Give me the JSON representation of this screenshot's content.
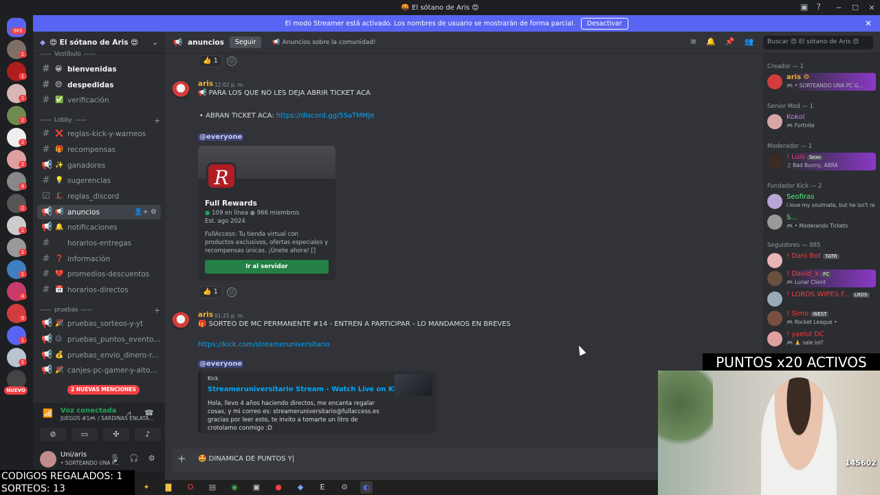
{
  "window": {
    "title": "🤬 El sótano de Aris 😍",
    "minimize": "─",
    "maximize": "☐",
    "close": "✕"
  },
  "banner": {
    "text": "El modo Streamer está activado. Los nombres de usuario se mostrarán de forma parcial.",
    "button": "Desactivar"
  },
  "rail": {
    "home_badge": "965",
    "nuevo": "NUEVO",
    "badges": [
      "1",
      "1",
      "1",
      "2",
      "1",
      "2",
      "4",
      "2",
      "1",
      "1",
      "1",
      "4",
      "5",
      "1",
      "1",
      "6",
      "1",
      "1"
    ]
  },
  "server": {
    "name": "😍 El sótano de Aris 😍"
  },
  "categories": {
    "vestibulo": "Vestíbulo",
    "lobby": "Lobby",
    "pruebas": "pruebas"
  },
  "channels": [
    {
      "emoji": "😀",
      "name": "bienvenidas"
    },
    {
      "emoji": "😔",
      "name": "despedidas"
    },
    {
      "emoji": "✅",
      "name": "verificación"
    },
    {
      "emoji": "❌",
      "name": "reglas-kick-y-warneos"
    },
    {
      "emoji": "🎁",
      "name": "recompensas"
    },
    {
      "emoji": "✨",
      "name": "ganadores"
    },
    {
      "emoji": "💡",
      "name": "sugerencias"
    },
    {
      "emoji": "🎩",
      "name": "reglas_discord"
    },
    {
      "emoji": "📢",
      "name": "anuncios"
    },
    {
      "emoji": "🔔",
      "name": "notificaciones"
    },
    {
      "emoji": "",
      "name": "horarios-entregas"
    },
    {
      "emoji": "❓",
      "name": "información"
    },
    {
      "emoji": "💔",
      "name": "promedios-descuentos"
    },
    {
      "emoji": "📅",
      "name": "horarios-directos"
    },
    {
      "emoji": "🎉",
      "name": "pruebas_sorteos-y-yt"
    },
    {
      "emoji": "😉",
      "name": "pruebas_puntos_evento..."
    },
    {
      "emoji": "💰",
      "name": "pruebas_envio_dinero-r..."
    },
    {
      "emoji": "🎉",
      "name": "canjes-pc-gamer-y-alto..."
    }
  ],
  "new_mentions": "2 NUEVAS MENCIONES",
  "voice": {
    "title": "Voz conectada",
    "subtitle": "JUEGOS #1🎮 / SARDINAS ENLATA..."
  },
  "user": {
    "name": "Uni/aris",
    "status": "• SORTEANDO UNA P..."
  },
  "channel_header": {
    "name": "anuncios",
    "follow": "Seguir",
    "topic": "📢 Anuncios sobre la comunidad!",
    "search": "Buscar 😍 El sótano de Aris 😍"
  },
  "messages": {
    "top_reaction": "👍 1",
    "m1": {
      "author": "aris",
      "time": "12:02 p. m.",
      "line1": "📢 PARA LOS QUE NO LES DEJA ABRIR TICKET ACA",
      "bullet_prefix": "ABRAN TICKET ACA: ",
      "bullet_link": "https://discord.gg/5SaTMMJe",
      "mention": "@everyone",
      "invite": {
        "name": "Full Rewards",
        "online": "109 en línea",
        "members": "966 miembros",
        "est": "Est. ago 2024",
        "desc": "FullAccess: Tu tienda virtual con productos exclusivos, ofertas especiales y recompensas únicas. ¡Únete ahora! []",
        "button": "Ir al servidor"
      },
      "reaction": "👍 1"
    },
    "m2": {
      "author": "aris",
      "time": "01:21 p. m.",
      "line1": "🎁 SORTEO DE MC PERMANENTE #14 - ENTREN A PARTICIPAR - LO MANDAMOS EN BREVES",
      "link": "https://kick.com/streameruniversitario",
      "mention": "@everyone",
      "embed": {
        "provider": "Kick",
        "title": "Streameruniversitario Stream - Watch Live on Kick",
        "desc": "Hola, llevo 4 años haciendo directos, me encanta regalar cosas, y mi correo es: streameruniversitario@fullaccess.es gracias por leer esto, te invito a tomarte un litro de crotolamo conmigo :D"
      }
    }
  },
  "composer": {
    "typed": "🤩 DINAMICA DE PUNTOS Y|"
  },
  "members": {
    "creador": "Creador — 1",
    "senior": "Senior Mod — 1",
    "moderador": "Moderador — 1",
    "fundador": "Fundador Kick — 2",
    "seguidores": "Seguidores — 885",
    "list": [
      {
        "name": "aris ⚙",
        "status": "🎮 • SORTEANDO UNA PC G..."
      },
      {
        "name": "Kokol",
        "status": "🎮 Fortnite"
      },
      {
        "name": "! Luis",
        "status": "♫ Bad Bunny, ABRA"
      },
      {
        "name": "Seofiras",
        "status": "i love my soulmate, but he isn't real"
      },
      {
        "name": "S...",
        "status": "🎮 • Moderando Tickets"
      },
      {
        "name": "! Dani Bot",
        "status": ""
      },
      {
        "name": "! David_x",
        "status": "🎮 Lunar Client"
      },
      {
        "name": "! LORDS WIPES F...",
        "status": ""
      },
      {
        "name": "! Simo",
        "status": "🎮 Rocket League •"
      },
      {
        "name": "! yaelol DC",
        "status": "🎮 🙏 sale lol?"
      }
    ],
    "tags": {
      "luis": "Sexo",
      "dani": "TATR",
      "david": "FC",
      "lords": "LRDS",
      "simo": "WEST"
    }
  },
  "overlay": {
    "puntos": "PUNTOS x20 ACTIVOS",
    "codigos": "CODIGOS REGALADOS: 1",
    "sorteos": "SORTEOS: 13",
    "webcam_watermark": "145602"
  },
  "colors": {
    "blurple": "#5865f2",
    "green": "#23a55a",
    "red": "#f23f43",
    "link": "#00a8fc",
    "author": "#f0b132"
  }
}
